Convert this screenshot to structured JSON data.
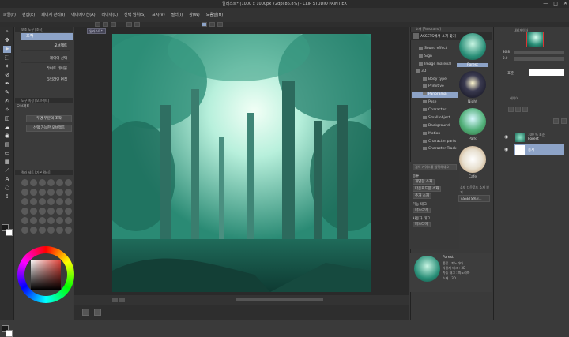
{
  "window": {
    "title": "일러스트* (1000 x 1000px 72dpi 86.8%) - CLIP STUDIO PAINT EX",
    "controls": [
      "—",
      "□",
      "✕"
    ]
  },
  "menu": [
    "파일(F)",
    "편집(E)",
    "페이지 관리(I)",
    "애니메이션(A)",
    "레이어(L)",
    "선택 범위(S)",
    "표시(V)",
    "필터(I)",
    "창(W)",
    "도움말(H)"
  ],
  "document_tab": "일러스트*",
  "tool_property": {
    "header": "보조 도구 [조작]",
    "selected": "조작",
    "object_button": "오브젝트",
    "subtools": [
      "레이어 선택",
      "라이트 테이블",
      "타임라인 편집"
    ],
    "sub_header": "도구 속성 [오브젝트]",
    "object_label": "오브젝트",
    "buttons": [
      "투명 부분의 조작",
      "선택 가능한 오브젝트"
    ]
  },
  "swatch_header": "컬러 세트 [기본 컬러]",
  "material": {
    "header": "소재 [Panorama]",
    "panel_label": "ASSETS에서 소재 찾기",
    "tree": [
      "Sound effect",
      "Sign",
      "Image material",
      "3D",
      "Body type",
      "Primitive",
      "Panorama",
      "Pose",
      "Character",
      "Small object",
      "Background",
      "Motion",
      "Character parts",
      "Character Track"
    ],
    "thumbs": [
      {
        "label": "Forest"
      },
      {
        "label": "Night"
      },
      {
        "label": "Park"
      },
      {
        "label": "Cafe"
      }
    ],
    "search_label": "검색 키워드를 입력하세요",
    "tag_header": "종류",
    "tags": [
      "개별한 소재",
      "다운로드한 소재",
      "추가 소재"
    ],
    "avail_label": "가능 태그",
    "avail_tags": [
      "파노라마"
    ],
    "user_label": "사용자 태그",
    "user_tags": [
      "파노라마"
    ],
    "store_note": "소재 다운로드 소재 보기",
    "assets_btn": "ASSETS에서...",
    "detail": {
      "name": "Forest",
      "type": "종류 : 파노라마",
      "type2": "사용자 태그 : 3D",
      "tags": "가능 태그 : 파노라마",
      "folder": "소재 : 3D"
    }
  },
  "navigator": {
    "header": "내비게이터",
    "zoom": "86.8",
    "angle": "0.0"
  },
  "layers": {
    "header": "레이어",
    "blend": "표준",
    "opacity": "100",
    "items": [
      {
        "name": "Forest",
        "sub": "100 % 표준"
      },
      {
        "name": "용지",
        "sub": ""
      }
    ]
  },
  "colors": {
    "accent": "#8da3c7",
    "bg": "#3a3a3a",
    "dark": "#2b2b2b",
    "fg_color": "#1a1a1a",
    "bg_color": "#ffffff"
  }
}
